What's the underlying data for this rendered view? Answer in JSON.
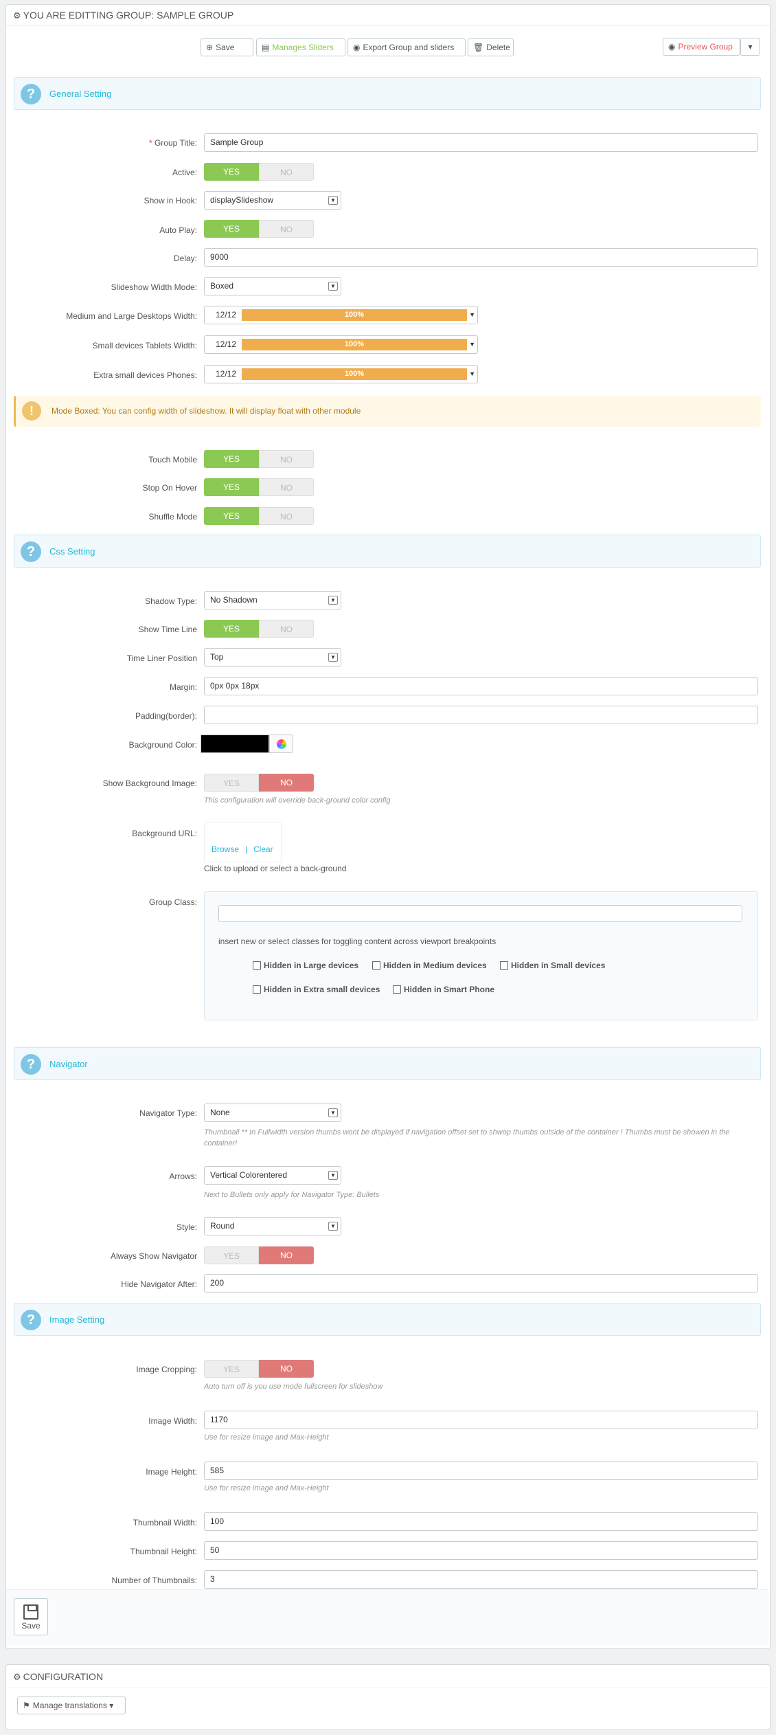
{
  "header": {
    "title": "YOU ARE EDITTING GROUP: SAMPLE GROUP",
    "save": "Save",
    "manage_sliders": "Manages Sliders",
    "export": "Export Group and sliders",
    "delete": "Delete",
    "preview": "Preview Group"
  },
  "general": {
    "section_title": "General Setting",
    "group_title_label": "Group Title:",
    "group_title_value": "Sample Group",
    "active_label": "Active:",
    "show_in_hook_label": "Show in Hook:",
    "show_in_hook_value": "displaySlideshow",
    "auto_play_label": "Auto Play:",
    "delay_label": "Delay:",
    "delay_value": "9000",
    "width_mode_label": "Slideshow Width Mode:",
    "width_mode_value": "Boxed",
    "md_lg_label": "Medium and Large Desktops Width:",
    "sm_label": "Small devices Tablets Width:",
    "xs_label": "Extra small devices Phones:",
    "cols": "12/12",
    "pct": "100%",
    "warning": "Mode Boxed: You can config width of slideshow. It will display float with other module",
    "touch_label": "Touch Mobile",
    "stop_label": "Stop On Hover",
    "shuffle_label": "Shuffle Mode"
  },
  "css": {
    "section_title": "Css Setting",
    "shadow_label": "Shadow Type:",
    "shadow_value": "No Shadown",
    "timeline_label": "Show Time Line",
    "timeline_pos_label": "Time Liner Position",
    "timeline_pos_value": "Top",
    "margin_label": "Margin:",
    "margin_value": "0px 0px 18px",
    "padding_label": "Padding(border):",
    "padding_value": "",
    "bg_color_label": "Background Color:",
    "show_bg_image_label": "Show Background Image:",
    "bg_image_help": "This configuration will override back-ground color config",
    "bg_url_label": "Background URL:",
    "browse": "Browse",
    "sep": "|",
    "clear": "Clear",
    "upload_help": "Click to upload or select a back-ground",
    "group_class_label": "Group Class:",
    "group_class_help": "insert new or select classes for toggling content across viewport breakpoints",
    "hide_large": "Hidden in Large devices",
    "hide_medium": "Hidden in Medium devices",
    "hide_small": "Hidden in Small devices",
    "hide_xs": "Hidden in Extra small devices",
    "hide_phone": "Hidden in Smart Phone"
  },
  "navigator": {
    "section_title": "Navigator",
    "type_label": "Navigator Type:",
    "type_value": "None",
    "type_help": "Thumbnail ** In Fullwidth version thumbs wont be displayed if navigation offset set to shwop thumbs outside of the container ! Thumbs must be showen in the container!",
    "arrows_label": "Arrows:",
    "arrows_value": "Vertical Colorentered",
    "arrows_help": "Next to Bullets only apply for Navigator Type: Bullets",
    "style_label": "Style:",
    "style_value": "Round",
    "always_label": "Always Show Navigator",
    "hide_after_label": "Hide Navigator After:",
    "hide_after_value": "200"
  },
  "image": {
    "section_title": "Image Setting",
    "cropping_label": "Image Cropping:",
    "cropping_help": "Auto turn off is you use mode fullscreen for slideshow",
    "width_label": "Image Width:",
    "width_value": "1170",
    "width_help": "Use for resize image and Max-Height",
    "height_label": "Image Height:",
    "height_value": "585",
    "height_help": "Use for resize image and Max-Height",
    "thumb_w_label": "Thumbnail Width:",
    "thumb_w_value": "100",
    "thumb_h_label": "Thumbnail Height:",
    "thumb_h_value": "50",
    "num_thumbs_label": "Number of Thumbnails:",
    "num_thumbs_value": "3"
  },
  "footer": {
    "save": "Save"
  },
  "config": {
    "title": "CONFIGURATION",
    "manage_translations": "Manage translations"
  },
  "switch": {
    "yes": "YES",
    "no": "NO"
  }
}
